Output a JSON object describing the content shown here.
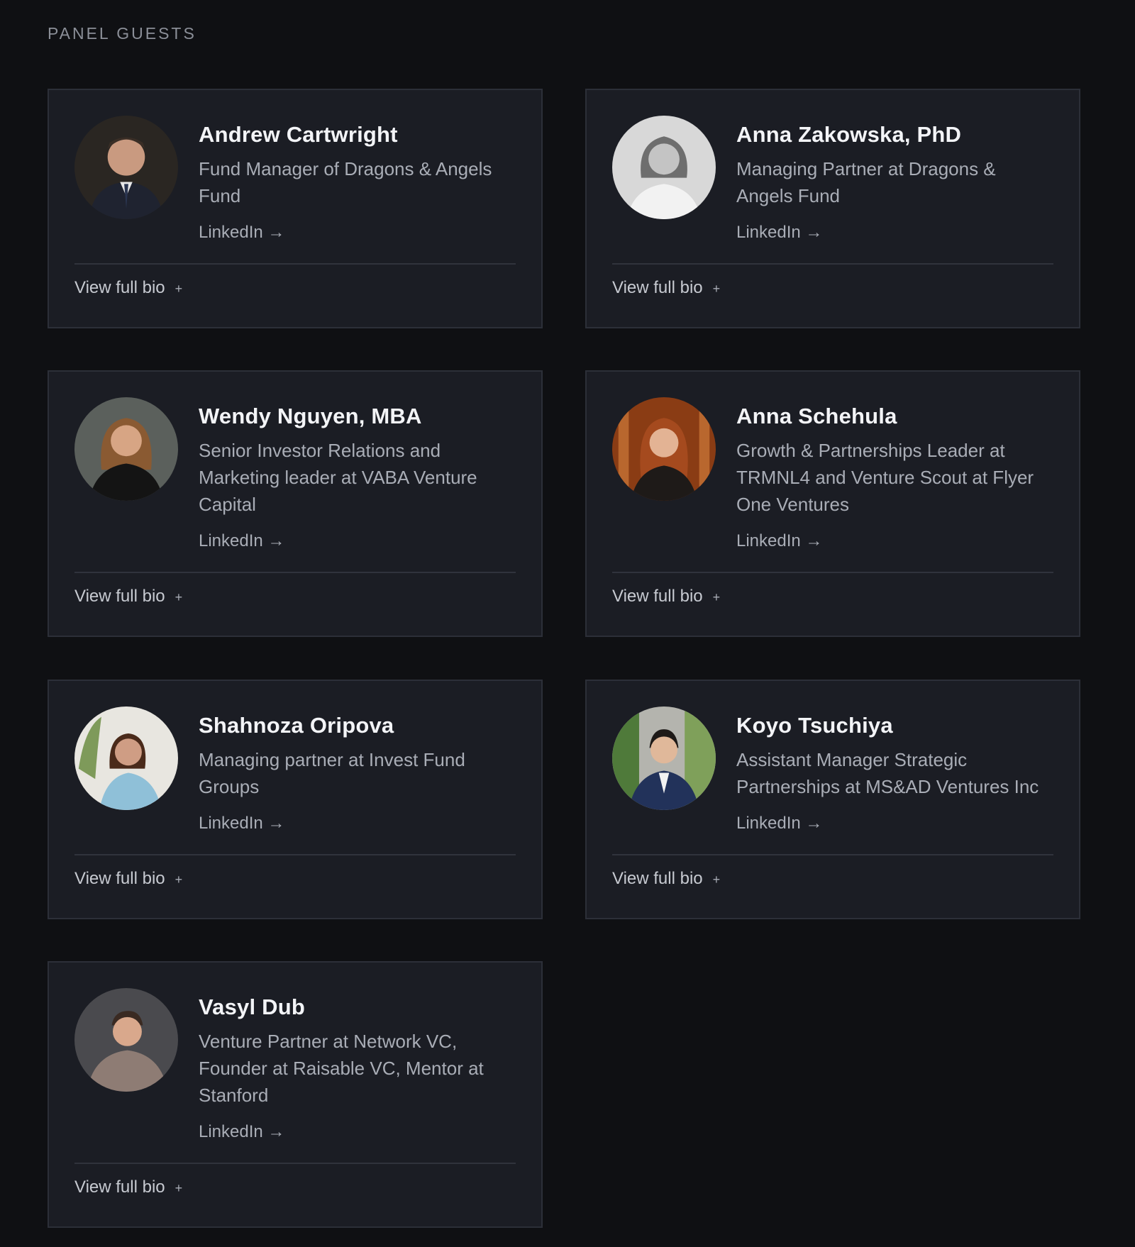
{
  "section": {
    "title": "PANEL GUESTS"
  },
  "guests": [
    {
      "name": "Andrew Cartwright",
      "role": "Fund Manager of Dragons & Angels Fund",
      "link_label": "LinkedIn →",
      "bio_label": "View full bio",
      "bio_icon": "+"
    },
    {
      "name": "Anna Zakowska, PhD",
      "role": "Managing Partner at Dragons & Angels Fund",
      "link_label": "LinkedIn →",
      "bio_label": "View full bio",
      "bio_icon": "+"
    },
    {
      "name": "Wendy Nguyen, MBA",
      "role": "Senior Investor Relations and Marketing leader at VABA Venture Capital",
      "link_label": "LinkedIn →",
      "bio_label": "View full bio",
      "bio_icon": "+"
    },
    {
      "name": "Anna Schehula",
      "role": "Growth & Partnerships Leader at TRMNL4 and Venture Scout at Flyer One Ventures",
      "link_label": "LinkedIn →",
      "bio_label": "View full bio",
      "bio_icon": "+"
    },
    {
      "name": "Shahnoza Oripova",
      "role": "Managing partner at Invest Fund Groups",
      "link_label": "LinkedIn →",
      "bio_label": "View full bio",
      "bio_icon": "+"
    },
    {
      "name": "Koyo Tsuchiya",
      "role": "Assistant Manager Strategic Partnerships at MS&AD Ventures Inc",
      "link_label": "LinkedIn →",
      "bio_label": "View full bio",
      "bio_icon": "+"
    },
    {
      "name": "Vasyl Dub",
      "role": "Venture Partner at Network VC, Founder at Raisable VC, Mentor at Stanford",
      "link_label": "LinkedIn →",
      "bio_label": "View full bio",
      "bio_icon": "+"
    }
  ]
}
